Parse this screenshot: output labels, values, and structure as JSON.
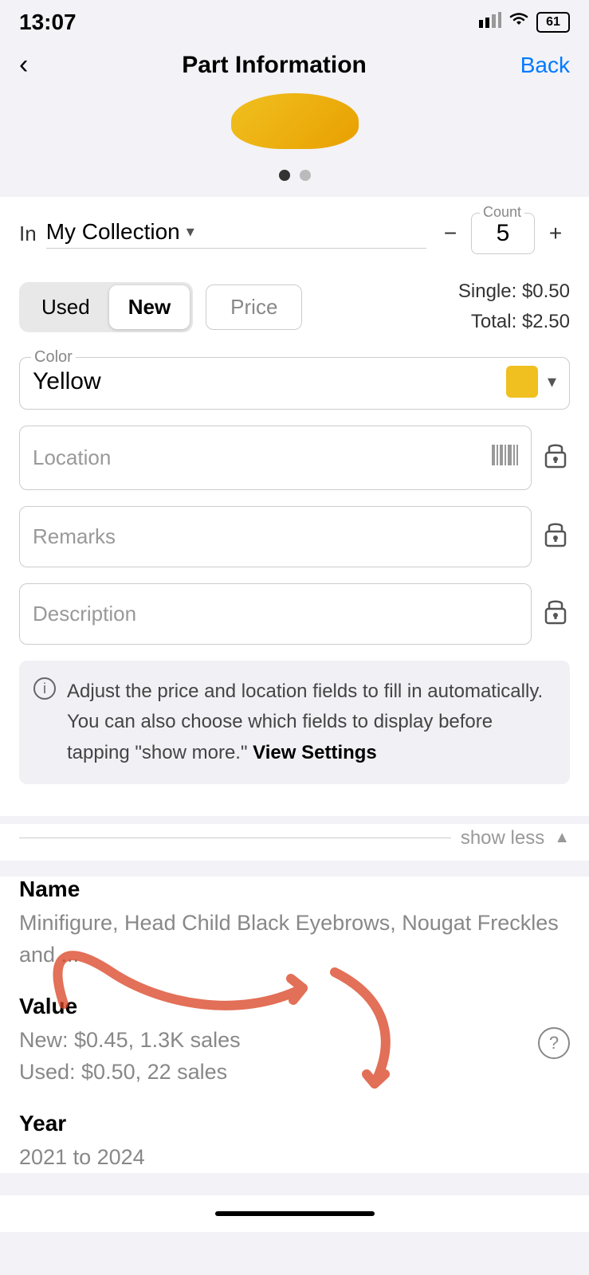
{
  "statusBar": {
    "time": "13:07",
    "signal": "▂▄",
    "wifi": "wifi",
    "battery": "61"
  },
  "nav": {
    "backArrow": "‹",
    "title": "Part Information",
    "backLabel": "Back"
  },
  "carousel": {
    "activeDot": 0,
    "totalDots": 2
  },
  "collection": {
    "inLabel": "In",
    "name": "My Collection",
    "count": {
      "label": "Count",
      "value": "5"
    }
  },
  "condition": {
    "used": "Used",
    "new": "New",
    "activeCondition": "new"
  },
  "price": {
    "buttonLabel": "Price",
    "single": "Single: $0.50",
    "total": "Total: $2.50"
  },
  "color": {
    "legend": "Color",
    "name": "Yellow",
    "swatchColor": "#f0c020"
  },
  "fields": {
    "location": {
      "placeholder": "Location"
    },
    "remarks": {
      "placeholder": "Remarks"
    },
    "description": {
      "placeholder": "Description"
    }
  },
  "infoBox": {
    "text": "Adjust the price and location fields to fill in automatically. You can also choose which fields to display before tapping \"show more.\"",
    "linkLabel": "View Settings"
  },
  "showLess": {
    "label": "show less"
  },
  "partDetails": {
    "nameLabel": "Name",
    "nameValue": "Minifigure, Head Child Black Eyebrows, Nougat Freckles and ...",
    "valueLabel": "Value",
    "valueNew": "New: $0.45, 1.3K sales",
    "valueUsed": "Used: $0.50, 22 sales",
    "yearLabel": "Year",
    "yearValue": "2021 to 2024"
  },
  "homeIndicator": {}
}
